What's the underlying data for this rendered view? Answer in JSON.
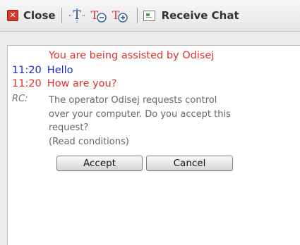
{
  "toolbar": {
    "close_label": "Close",
    "receive_chat_label": "Receive Chat",
    "icons": [
      "close-icon",
      "font-style-icon",
      "decrease-font-icon",
      "increase-font-icon",
      "receive-chat-icon"
    ],
    "font_icon_glyph": "T"
  },
  "chat": {
    "notice": "You are being assisted by Odisej",
    "messages": [
      {
        "time": "11:20",
        "text": "Hello",
        "color": "#1c2ac9"
      },
      {
        "time": "11:20",
        "text": "How are you?",
        "color": "#e03131"
      }
    ],
    "rc_tag": "RC:",
    "rc_request": "The operator Odisej requests control over your computer. Do you accept this request?",
    "rc_link": "(Read conditions)",
    "accept_label": "Accept",
    "cancel_label": "Cancel"
  },
  "colors": {
    "operator": "#e03131",
    "visitor": "#1c2ac9",
    "system": "#666666"
  }
}
